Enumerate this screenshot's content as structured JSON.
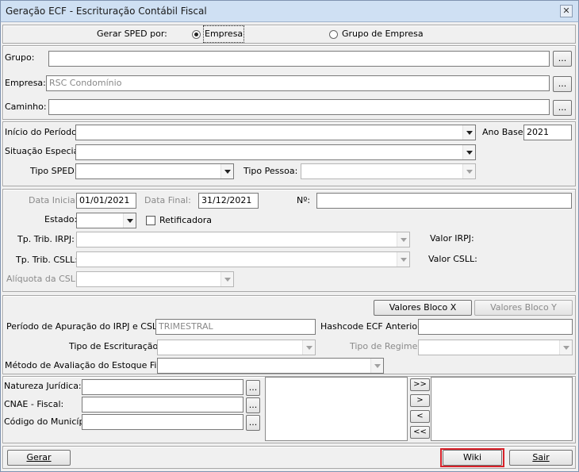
{
  "window": {
    "title": "Geração ECF - Escrituração Contábil Fiscal",
    "close_icon": "close-icon"
  },
  "gerar_sped": {
    "label": "Gerar SPED por:",
    "options": [
      {
        "label": "Empresa",
        "selected": true
      },
      {
        "label": "Grupo de Empresa",
        "selected": false
      }
    ]
  },
  "fields": {
    "grupo": {
      "label": "Grupo:",
      "value": "",
      "button": "..."
    },
    "empresa": {
      "label": "Empresa:",
      "value": "RSC Condomínio",
      "button": "..."
    },
    "caminho": {
      "label": "Caminho:",
      "value": "",
      "button": "..."
    }
  },
  "periodo": {
    "inicio_label": "Início do Período:",
    "inicio_value": "",
    "ano_base_label": "Ano Base:",
    "ano_base_value": "2021",
    "situacao_label": "Situação Especial:",
    "situacao_value": "",
    "tipo_sped_label": "Tipo SPED:",
    "tipo_sped_value": "",
    "tipo_pessoa_label": "Tipo Pessoa:",
    "tipo_pessoa_value": ""
  },
  "retificacao": {
    "data_inicial_label": "Data Inicial:",
    "data_inicial_value": "01/01/2021",
    "data_final_label": "Data Final:",
    "data_final_value": "31/12/2021",
    "numero_label": "Nº:",
    "numero_value": "",
    "estado_label": "Estado:",
    "estado_value": "",
    "retificadora_label": "Retificadora",
    "retificadora_checked": false,
    "tp_irpj_label": "Tp. Trib. IRPJ:",
    "tp_irpj_value": "",
    "valor_irpj_label": "Valor IRPJ:",
    "tp_csll_label": "Tp. Trib. CSLL:",
    "tp_csll_value": "",
    "valor_csll_label": "Valor CSLL:",
    "aliquota_label": "Alíquota da CSLL:",
    "aliquota_value": ""
  },
  "bloco": {
    "valores_x": "Valores Bloco X",
    "valores_y": "Valores Bloco Y",
    "periodo_label": "Período de Apuração do IRPJ e CSLL:",
    "periodo_value": "TRIMESTRAL",
    "hashcode_label": "Hashcode ECF Anterior:",
    "hashcode_value": "",
    "tipo_escrituracao_label": "Tipo de Escrituração:",
    "tipo_escrituracao_value": "",
    "tipo_regime_label": "Tipo de Regime:",
    "tipo_regime_value": "",
    "metodo_label": "Método de Avaliação do Estoque Final:",
    "metodo_value": ""
  },
  "cadastro": {
    "natureza_label": "Natureza Jurídica:",
    "cnae_label": "CNAE - Fiscal:",
    "municipio_label": "Código do Município:",
    "button": "...",
    "move_all_right": ">>",
    "move_right": ">",
    "move_left": "<",
    "move_all_left": "<<"
  },
  "footer": {
    "gerar": "Gerar",
    "wiki": "Wiki",
    "sair": "Sair"
  }
}
